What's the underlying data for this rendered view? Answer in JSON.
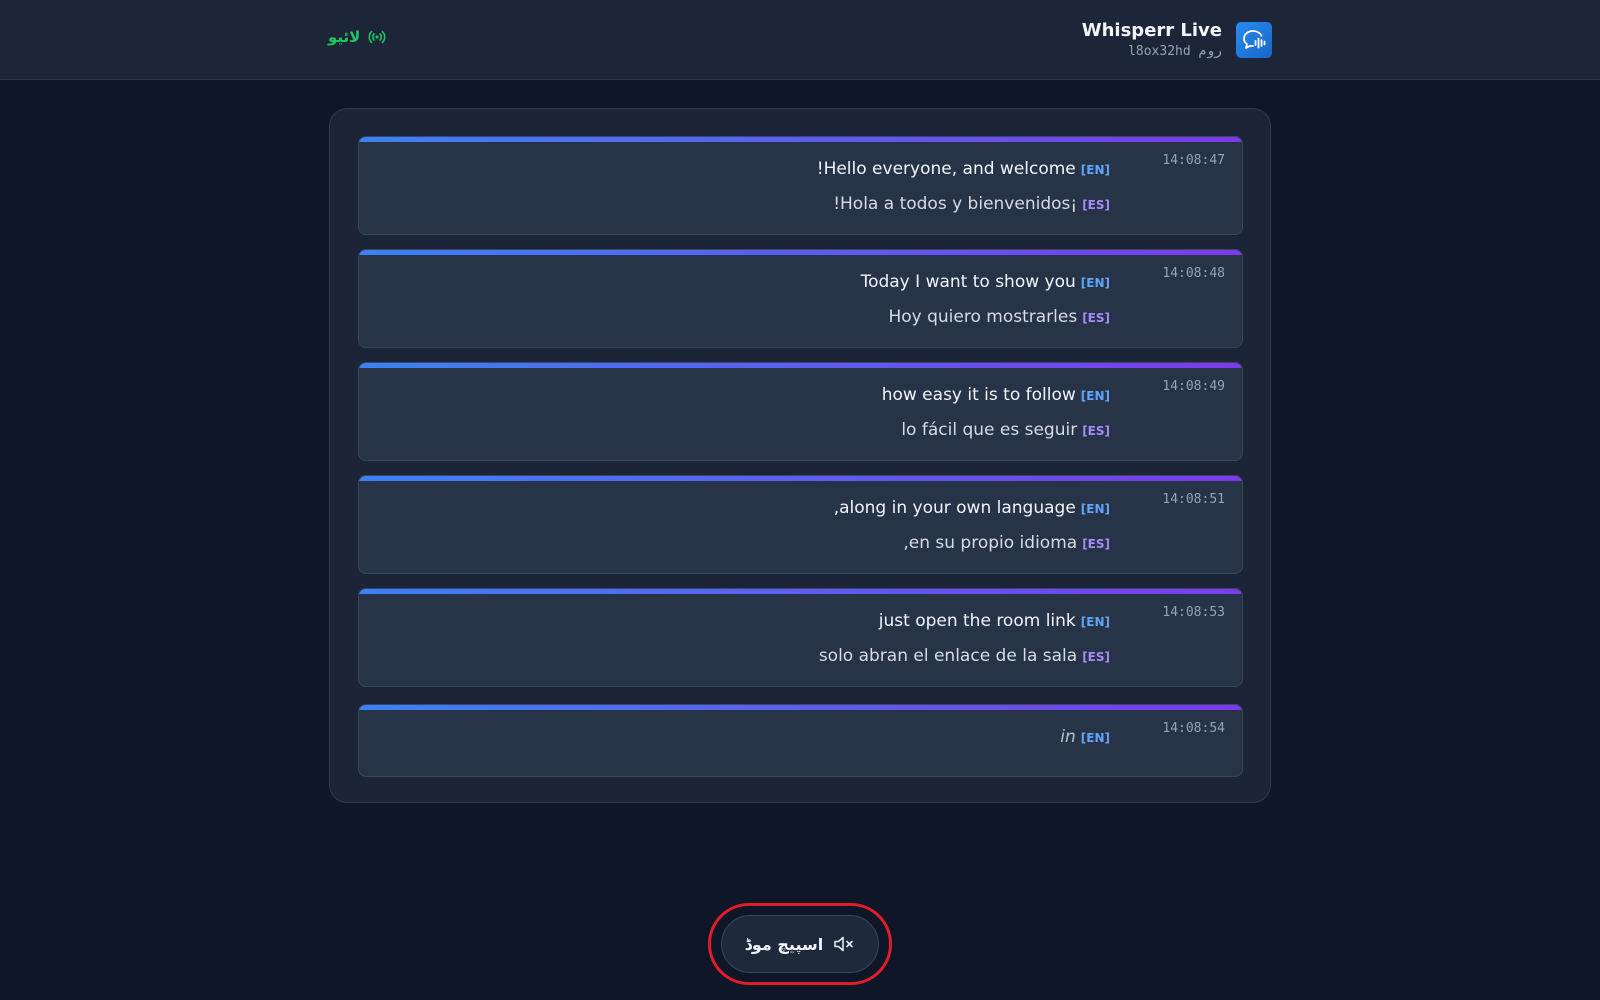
{
  "header": {
    "app_title": "Whisperr Live",
    "room_label": "روم",
    "room_code": "l8ox32hd",
    "live_label": "لائیو",
    "live_color": "#22c55e",
    "logo_icon": "speech-bubble-sound-icon",
    "live_icon": "broadcast-icon"
  },
  "transcript": [
    {
      "time": "14:08:47",
      "en": "!Hello everyone, and welcome",
      "es": "!Hola a todos y bienvenidos¡",
      "en_tag": "[EN]",
      "es_tag": "[ES]"
    },
    {
      "time": "14:08:48",
      "en": "Today I want to show you",
      "es": "Hoy quiero mostrarles",
      "en_tag": "[EN]",
      "es_tag": "[ES]"
    },
    {
      "time": "14:08:49",
      "en": "how easy it is to follow",
      "es": "lo fácil que es seguir",
      "en_tag": "[EN]",
      "es_tag": "[ES]"
    },
    {
      "time": "14:08:51",
      "en": ",along in your own language",
      "es": ",en su propio idioma",
      "en_tag": "[EN]",
      "es_tag": "[ES]"
    },
    {
      "time": "14:08:53",
      "en": "just open the room link",
      "es": "solo abran el enlace de la sala",
      "en_tag": "[EN]",
      "es_tag": "[ES]"
    },
    {
      "time": "14:08:54",
      "en": "in",
      "en_tag": "[EN]"
    }
  ],
  "speech_mode": {
    "label": "اسپیچ موڈ",
    "icon": "speaker-muted-icon"
  },
  "colors": {
    "accent_blue": "#3b82f6",
    "accent_purple": "#7c3aed",
    "highlight_red": "#e11d2a"
  }
}
